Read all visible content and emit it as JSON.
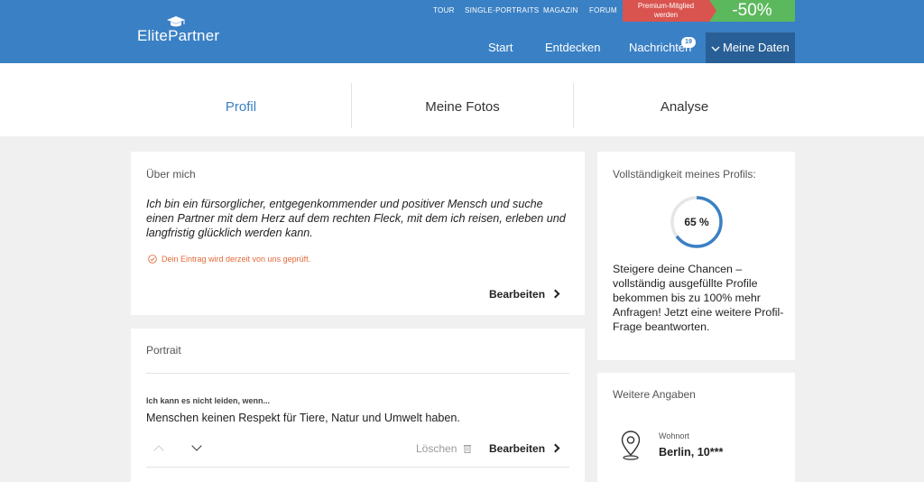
{
  "header": {
    "brand": "ElitePartner",
    "top_links": [
      "TOUR",
      "SINGLE-PORTRAITS",
      "MAGAZIN",
      "FORUM"
    ],
    "premium_line1": "Premium-Mitglied",
    "premium_line2": "werden",
    "discount": "-50%",
    "nav": [
      "Start",
      "Entdecken",
      "Nachrichten"
    ],
    "messages_count": "19",
    "my_data": "Meine Daten"
  },
  "tabs": [
    "Profil",
    "Meine Fotos",
    "Analyse"
  ],
  "about": {
    "title": "Über mich",
    "text": "Ich bin ein fürsorglicher, entgegenkommender und positiver Mensch und suche einen Partner mit dem Herz auf dem rechten Fleck, mit dem ich reisen, erleben und langfristig glücklich werden kann.",
    "review_note": "Dein Eintrag wird derzeit von uns geprüft.",
    "edit_label": "Bearbeiten"
  },
  "portrait": {
    "title": "Portrait",
    "question": "Ich kann es nicht leiden, wenn...",
    "answer": "Menschen keinen Respekt für Tiere, Natur und Umwelt haben.",
    "delete_label": "Löschen",
    "edit_label": "Bearbeiten"
  },
  "completeness": {
    "title": "Vollständigkeit meines Profils:",
    "percent": 65,
    "percent_label": "65 %",
    "tip": "Steigere deine Chancen – vollständig ausgefüllte Profile bekommen bis zu 100% mehr Anfragen! Jetzt eine weitere Profil-Frage beantworten."
  },
  "more_info": {
    "title": "Weitere Angaben",
    "location_label": "Wohnort",
    "location_value": "Berlin, 10***"
  },
  "colors": {
    "primary": "#3a80c4",
    "nav_dark": "#285f96",
    "premium": "#d9534f",
    "discount": "#5cb85c",
    "warning": "#e36a3a"
  },
  "icons": [
    "graduation-cap-icon",
    "clock-check-icon",
    "chevron-right-icon",
    "chevron-up-icon",
    "chevron-down-icon",
    "trash-icon",
    "location-pin-icon"
  ]
}
